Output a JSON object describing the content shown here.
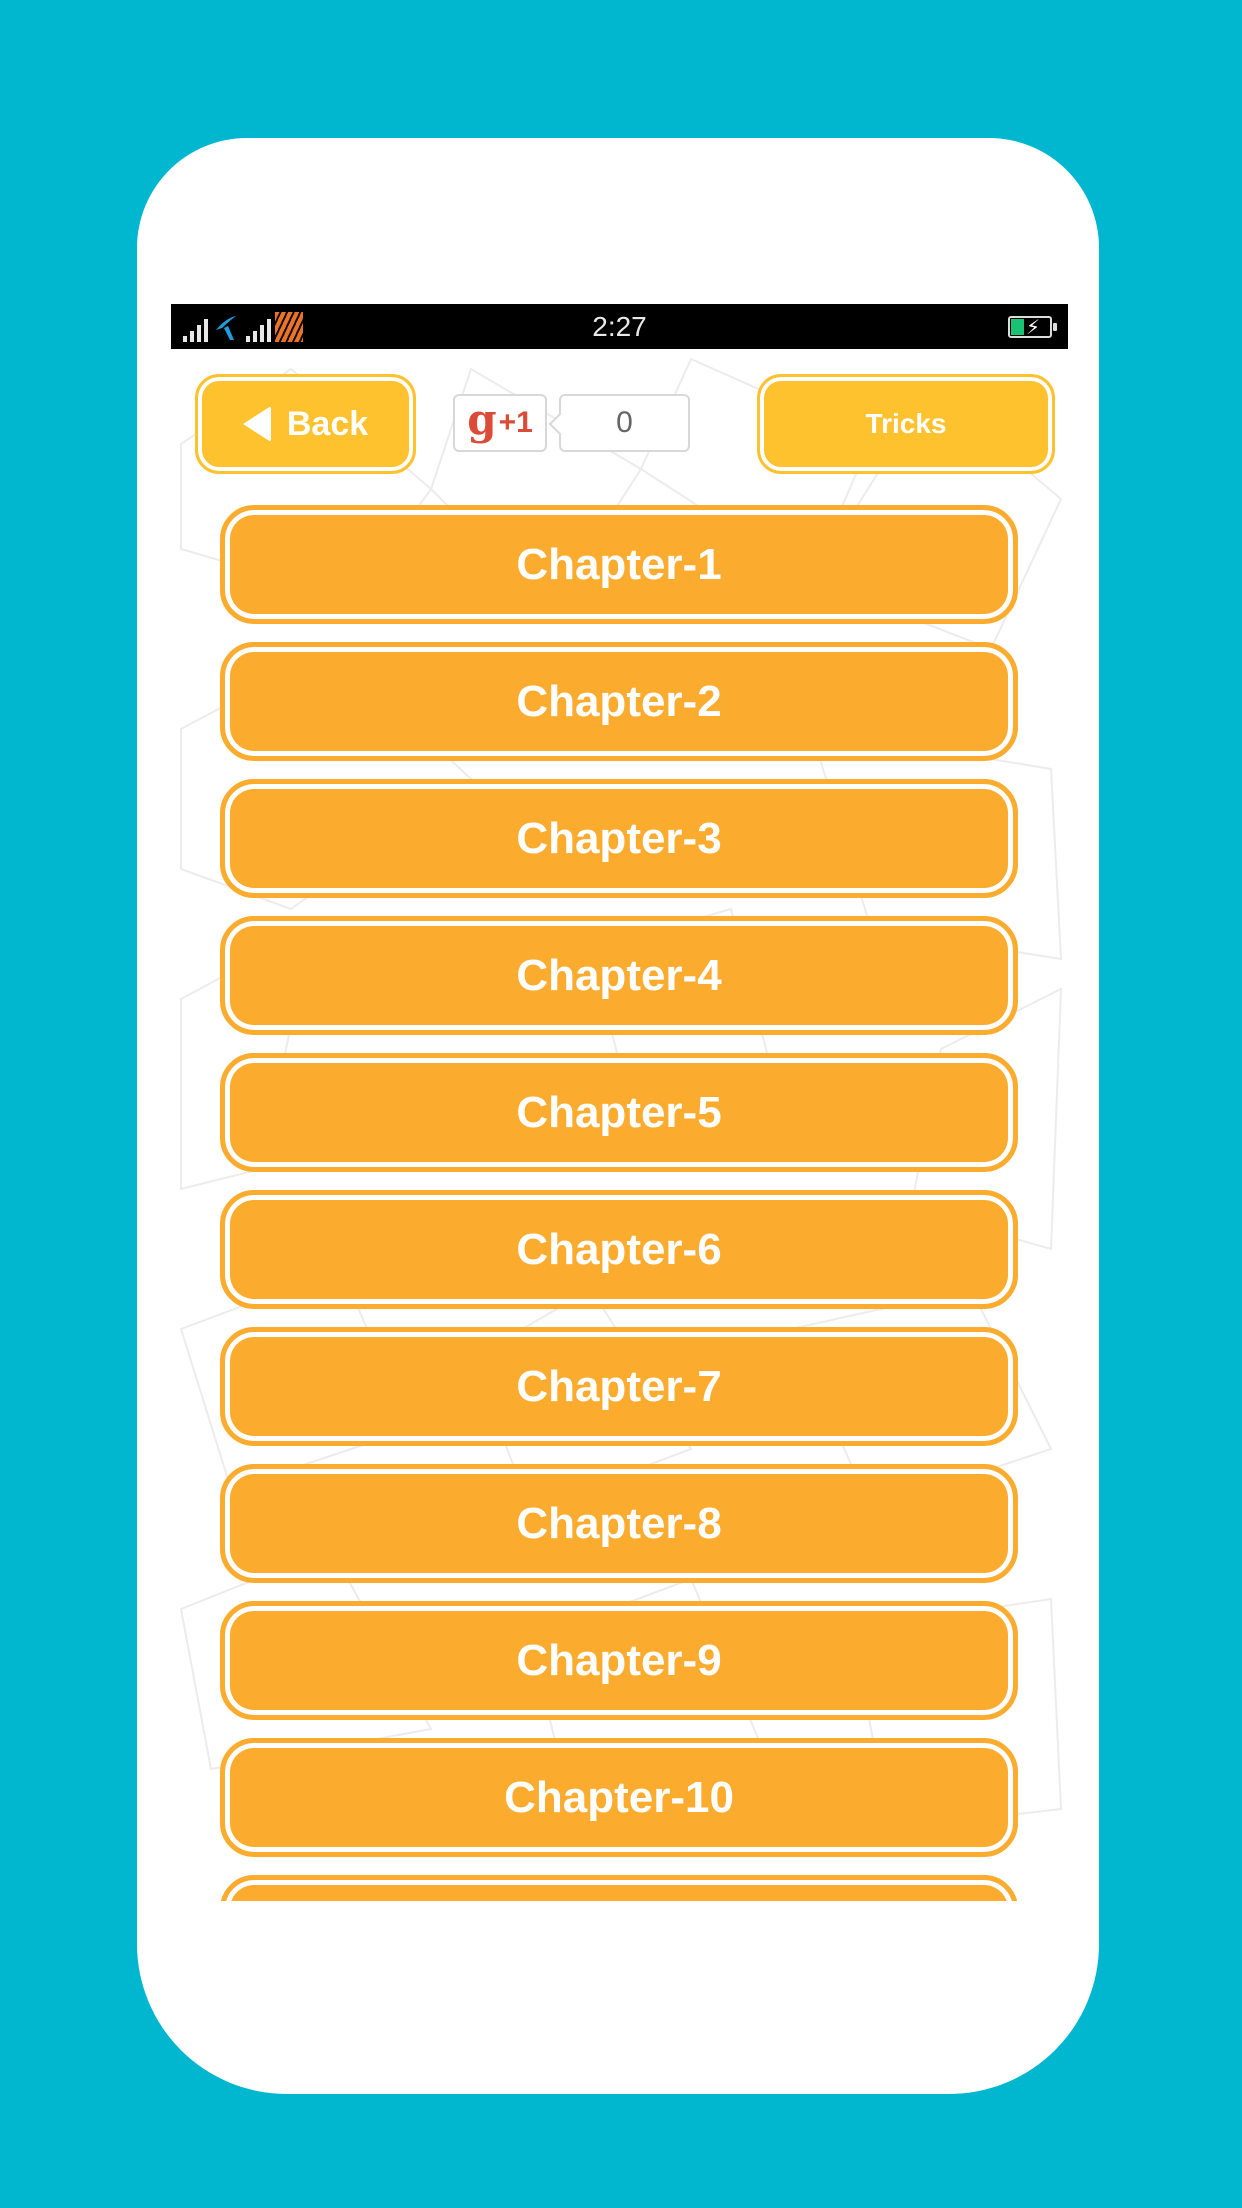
{
  "status_bar": {
    "time": "2:27",
    "icons": [
      "signal-icon",
      "carrier-logo-icon",
      "signal-icon",
      "carrier-tiger-icon",
      "battery-charging-icon"
    ],
    "battery_color": "#19c373"
  },
  "header": {
    "back_label": "Back",
    "gplus_label": "+1",
    "gplus_glyph": "g",
    "gplus_count": "0",
    "tricks_label": "Tricks"
  },
  "chapters": [
    {
      "label": "Chapter-1"
    },
    {
      "label": "Chapter-2"
    },
    {
      "label": "Chapter-3"
    },
    {
      "label": "Chapter-4"
    },
    {
      "label": "Chapter-5"
    },
    {
      "label": "Chapter-6"
    },
    {
      "label": "Chapter-7"
    },
    {
      "label": "Chapter-8"
    },
    {
      "label": "Chapter-9"
    },
    {
      "label": "Chapter-10"
    },
    {
      "label": ""
    }
  ],
  "colors": {
    "background": "#00b7cf",
    "top_button": "#fdc22e",
    "chapter_button": "#fbab2e",
    "gplus_red": "#dc4a38"
  }
}
